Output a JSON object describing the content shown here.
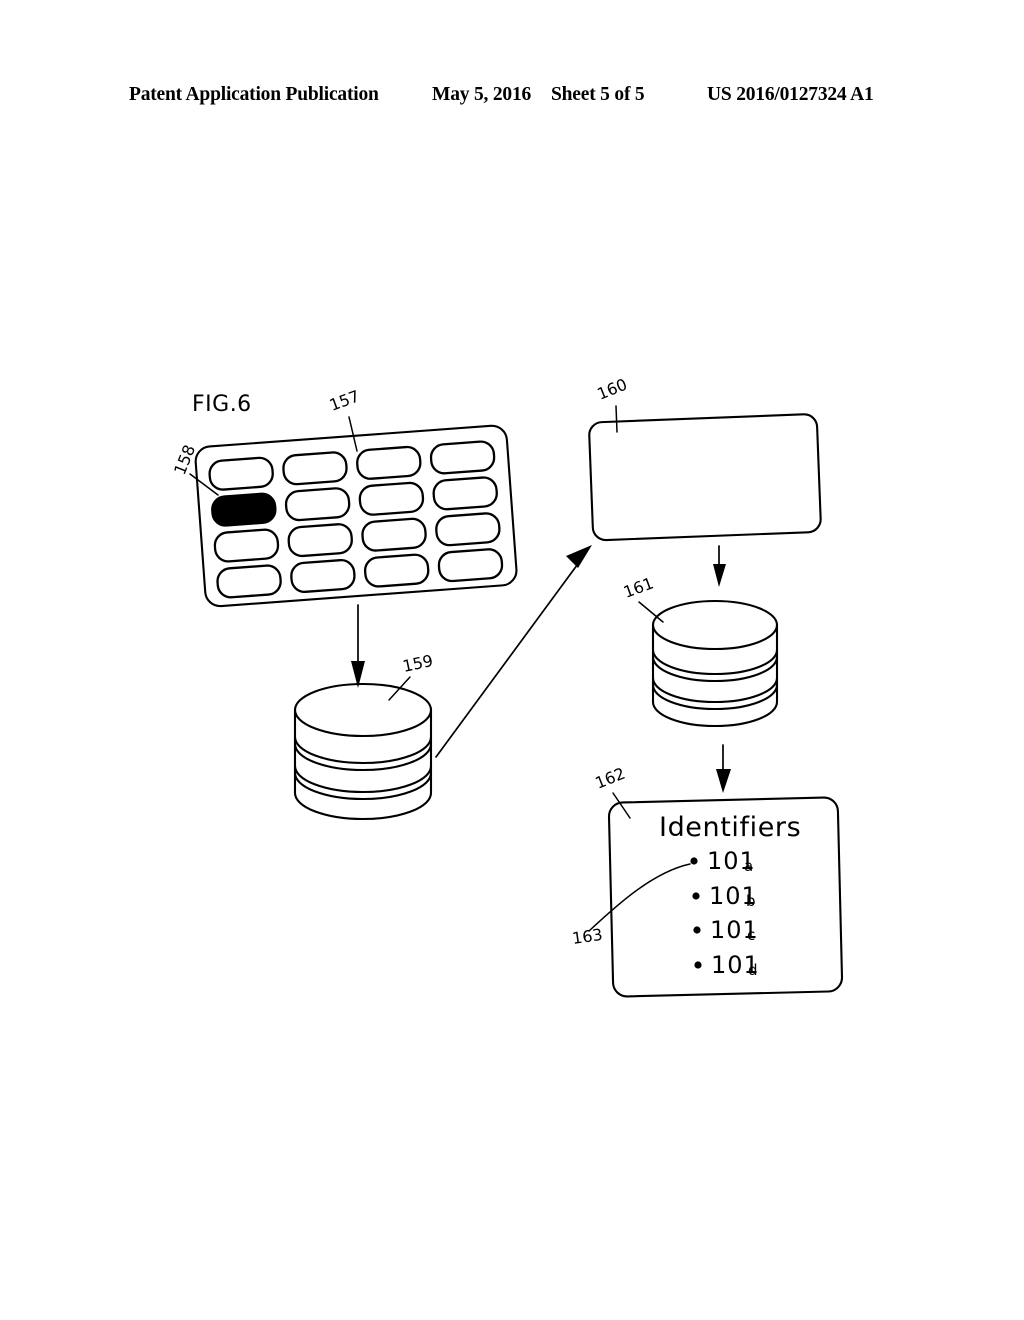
{
  "header": {
    "title": "Patent Application Publication",
    "date": "May 5, 2016",
    "sheet": "Sheet 5 of 5",
    "patent_number": "US 2016/0127324 A1"
  },
  "figure": {
    "label": "FIG.6"
  },
  "reference_numerals": {
    "blister_pack": "157",
    "selected_cell": "158",
    "database_first": "159",
    "device_box": "160",
    "database_second": "161",
    "identifiers_box": "162",
    "identifier_leader": "163"
  },
  "blister_pack": {
    "rows": 4,
    "columns": 4,
    "filled_cell": {
      "row": 2,
      "column": 1
    }
  },
  "identifiers_panel": {
    "title": "Identifiers",
    "items": [
      {
        "base": "101",
        "sub": "a"
      },
      {
        "base": "101",
        "sub": "b"
      },
      {
        "base": "101",
        "sub": "c"
      },
      {
        "base": "101",
        "sub": "d"
      }
    ]
  },
  "colors": {
    "ink": "#000000",
    "paper": "#ffffff"
  }
}
